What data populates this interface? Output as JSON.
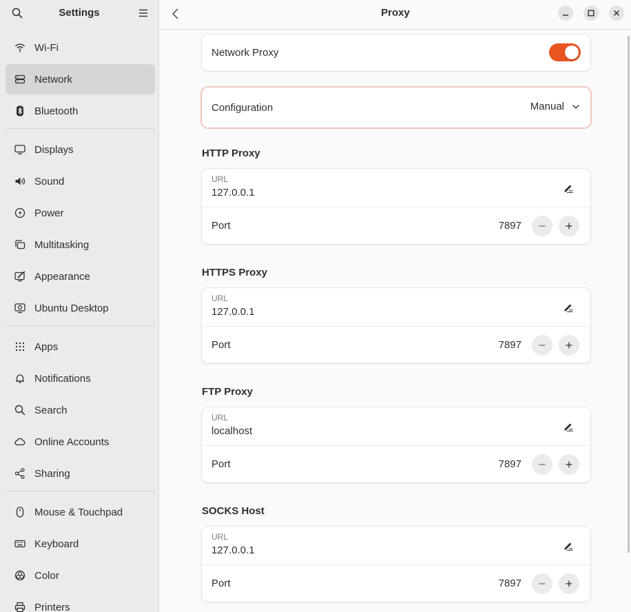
{
  "sidebar": {
    "title": "Settings",
    "items": [
      {
        "label": "Wi-Fi",
        "icon": "wifi-icon"
      },
      {
        "label": "Network",
        "icon": "network-icon",
        "active": true
      },
      {
        "label": "Bluetooth",
        "icon": "bluetooth-icon"
      },
      {
        "label": "Displays",
        "icon": "display-icon"
      },
      {
        "label": "Sound",
        "icon": "speaker-icon"
      },
      {
        "label": "Power",
        "icon": "power-icon"
      },
      {
        "label": "Multitasking",
        "icon": "multitasking-icon"
      },
      {
        "label": "Appearance",
        "icon": "appearance-icon"
      },
      {
        "label": "Ubuntu Desktop",
        "icon": "ubuntu-desktop-icon"
      },
      {
        "label": "Apps",
        "icon": "apps-grid-icon"
      },
      {
        "label": "Notifications",
        "icon": "bell-icon"
      },
      {
        "label": "Search",
        "icon": "search-icon"
      },
      {
        "label": "Online Accounts",
        "icon": "cloud-icon"
      },
      {
        "label": "Sharing",
        "icon": "share-icon"
      },
      {
        "label": "Mouse & Touchpad",
        "icon": "mouse-icon"
      },
      {
        "label": "Keyboard",
        "icon": "keyboard-icon"
      },
      {
        "label": "Color",
        "icon": "color-icon"
      },
      {
        "label": "Printers",
        "icon": "printer-icon"
      }
    ]
  },
  "header": {
    "title": "Proxy"
  },
  "proxy": {
    "network_proxy_label": "Network Proxy",
    "network_proxy_enabled": true,
    "configuration_label": "Configuration",
    "configuration_value": "Manual",
    "sections": [
      {
        "title": "HTTP Proxy",
        "url_caption": "URL",
        "url": "127.0.0.1",
        "port_label": "Port",
        "port": "7897"
      },
      {
        "title": "HTTPS Proxy",
        "url_caption": "URL",
        "url": "127.0.0.1",
        "port_label": "Port",
        "port": "7897"
      },
      {
        "title": "FTP Proxy",
        "url_caption": "URL",
        "url": "localhost",
        "port_label": "Port",
        "port": "7897"
      },
      {
        "title": "SOCKS Host",
        "url_caption": "URL",
        "url": "127.0.0.1",
        "port_label": "Port",
        "port": "7897"
      }
    ]
  },
  "colors": {
    "accent": "#e95420",
    "sidebar_bg": "#ebebeb",
    "active_item_bg": "#d6d6d6"
  }
}
